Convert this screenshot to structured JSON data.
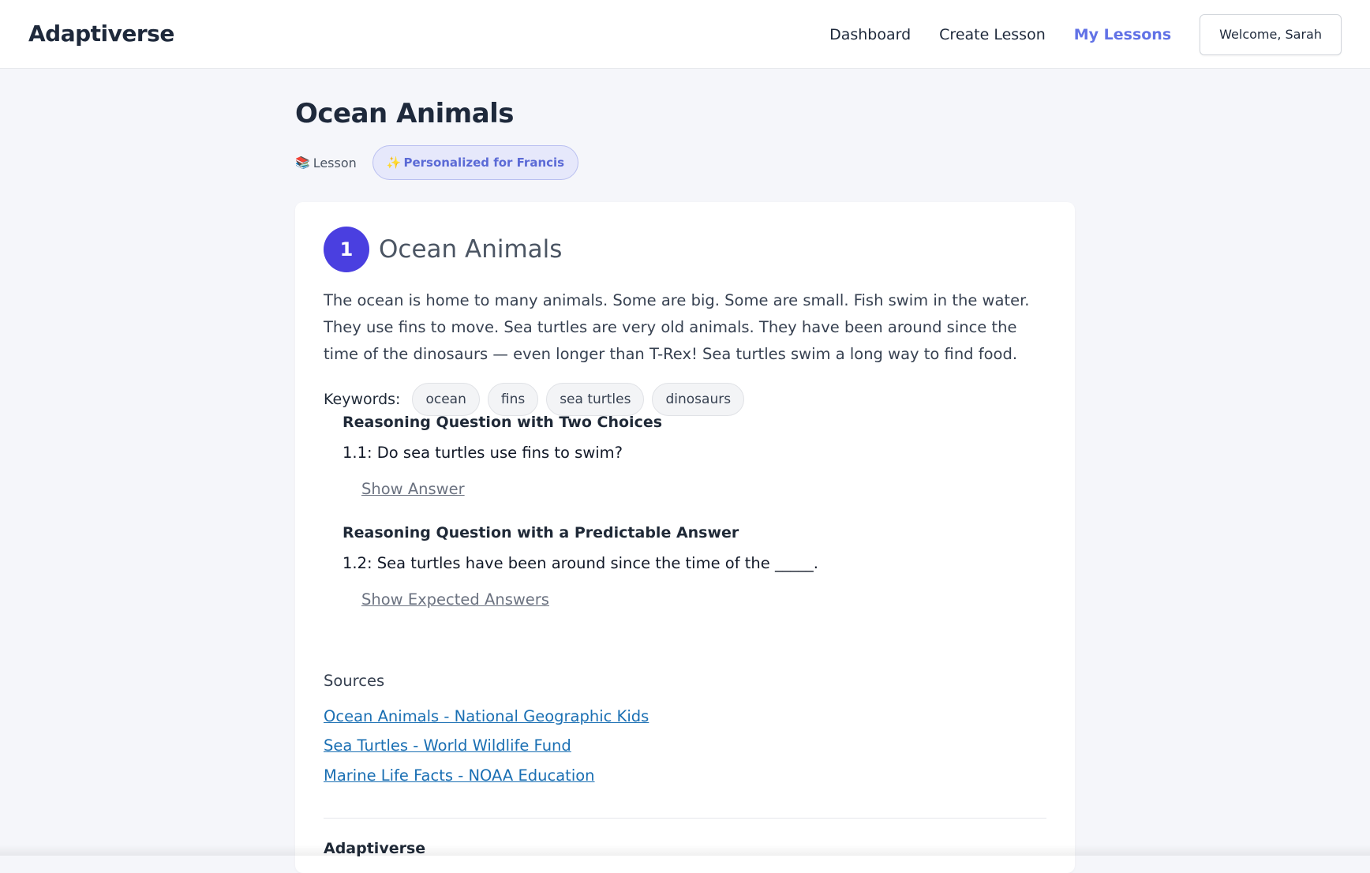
{
  "app": {
    "brand": "Adaptiverse"
  },
  "nav": {
    "items": [
      {
        "label": "Dashboard",
        "active": false
      },
      {
        "label": "Create Lesson",
        "active": false
      },
      {
        "label": "My Lessons",
        "active": true
      }
    ],
    "welcome": "Welcome, Sarah"
  },
  "page": {
    "title": "Ocean Animals",
    "type_label": "Lesson",
    "type_icon": "books-icon",
    "personalized_label": "Personalized for Francis",
    "personalized_icon": "sparkles-icon"
  },
  "section": {
    "number": "1",
    "title": "Ocean Animals",
    "passage": "The ocean is home to many animals. Some are big. Some are small. Fish swim in the water. They use fins to move. Sea turtles are very old animals. They have been around since the time of the dinosaurs — even longer than T-Rex! Sea turtles swim a long way to find food.",
    "keywords_label": "Keywords:",
    "keywords": [
      "ocean",
      "fins",
      "sea turtles",
      "dinosaurs"
    ],
    "questions": [
      {
        "type": "Reasoning Question with Two Choices",
        "text": "1.1: Do sea turtles use fins to swim?",
        "reveal": "Show Answer"
      },
      {
        "type": "Reasoning Question with a Predictable Answer",
        "text": "1.2: Sea turtles have been around since the time of the _____.",
        "reveal": "Show Expected Answers"
      }
    ],
    "sources_title": "Sources",
    "sources": [
      "Ocean Animals - National Geographic Kids",
      "Sea Turtles - World Wildlife Fund",
      "Marine Life Facts - NOAA Education"
    ]
  },
  "footer": {
    "brand": "Adaptiverse"
  },
  "colors": {
    "accent": "#6172e6",
    "section_badge": "#4a3fe0",
    "link": "#1a6fb3",
    "background": "#f5f6fa"
  }
}
